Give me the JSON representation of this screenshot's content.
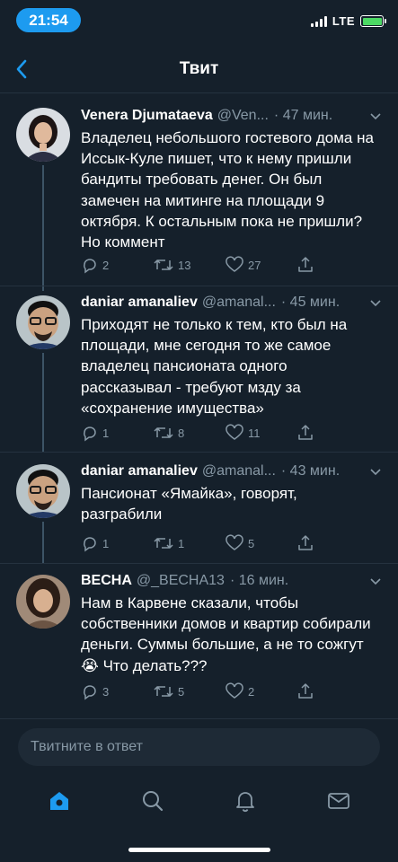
{
  "status_bar": {
    "time": "21:54",
    "network": "LTE"
  },
  "header": {
    "title": "Твит"
  },
  "tweets": [
    {
      "name": "Venera Djumataeva",
      "handle": "@Ven...",
      "time": "· 47 мин.",
      "text": "Владелец небольшого гостевого дома на Иссык-Куле пишет, что к нему пришли бандиты требовать денег. Он был замечен на митинге на площади 9 октября. К остальным пока не пришли? Но коммент",
      "replies": "2",
      "retweets": "13",
      "likes": "27"
    },
    {
      "name": "daniar amanaliev",
      "handle": "@amanal...",
      "time": "· 45 мин.",
      "text": "Приходят не только к тем, кто был на площади, мне сегодня то же самое владелец пансионата одного рассказывал - требуют мзду за «сохранение имущества»",
      "replies": "1",
      "retweets": "8",
      "likes": "11"
    },
    {
      "name": "daniar amanaliev",
      "handle": "@amanal...",
      "time": "· 43 мин.",
      "text": "Пансионат «Ямайка», говорят, разграбили",
      "replies": "1",
      "retweets": "1",
      "likes": "5"
    },
    {
      "name": "ВЕСНА",
      "handle": "@_ВЕСНА13",
      "time": "· 16 мин.",
      "text": "Нам в Карвене сказали, чтобы собственники домов и квартир собирали деньги. Суммы большие, а не то сожгут 😭 Что делать???",
      "replies": "3",
      "retweets": "5",
      "likes": "2"
    }
  ],
  "reply_box": {
    "placeholder": "Твитните в ответ"
  },
  "colors": {
    "background": "#15202b",
    "accent": "#1d9bf0",
    "muted": "#8899a6",
    "battery": "#4cd964"
  },
  "nav_icons": [
    "home-icon",
    "search-icon",
    "notifications-icon",
    "messages-icon"
  ]
}
